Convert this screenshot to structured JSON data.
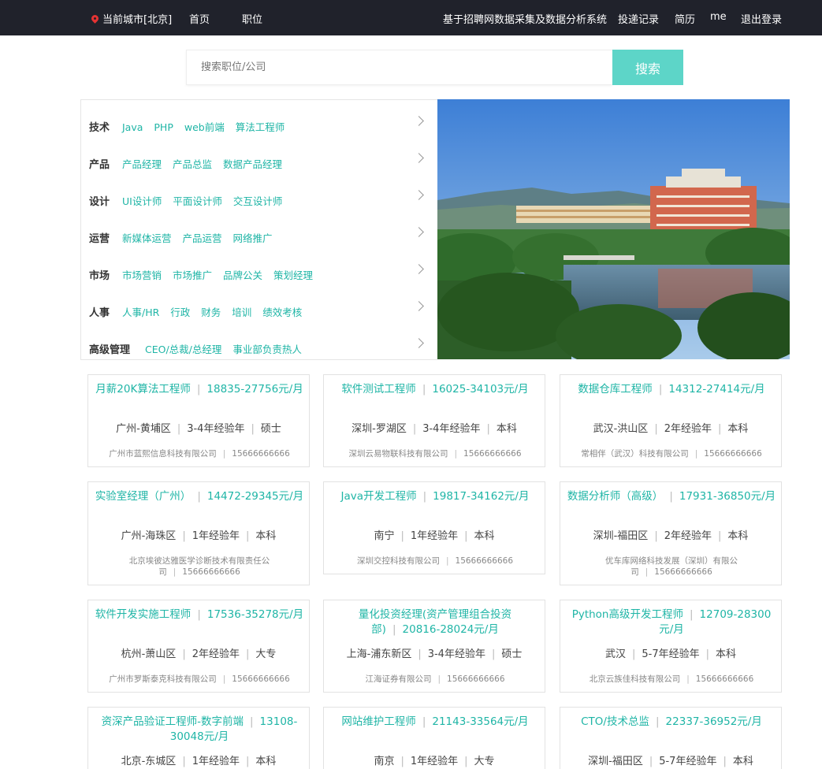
{
  "nav": {
    "city": "当前城市[北京]",
    "home": "首页",
    "jobs": "职位",
    "system": "基于招聘网数据采集及数据分析系统",
    "applications": "投递记录",
    "resume": "简历",
    "me": "me",
    "logout": "退出登录"
  },
  "search": {
    "placeholder": "搜索职位/公司",
    "button": "搜索"
  },
  "categories": [
    {
      "title": "技术",
      "links": [
        "Java",
        "PHP",
        "web前端",
        "算法工程师"
      ]
    },
    {
      "title": "产品",
      "links": [
        "产品经理",
        "产品总监",
        "数据产品经理"
      ]
    },
    {
      "title": "设计",
      "links": [
        "UI设计师",
        "平面设计师",
        "交互设计师"
      ]
    },
    {
      "title": "运营",
      "links": [
        "新媒体运营",
        "产品运营",
        "网络推广"
      ]
    },
    {
      "title": "市场",
      "links": [
        "市场营销",
        "市场推广",
        "品牌公关",
        "策划经理"
      ]
    },
    {
      "title": "人事",
      "links": [
        "人事/HR",
        "行政",
        "财务",
        "培训",
        "绩效考核"
      ]
    },
    {
      "title": "高级管理",
      "links": [
        "CEO/总裁/总经理",
        "事业部负责热人"
      ]
    }
  ],
  "separator": "|",
  "jobs": [
    {
      "title": "月薪20K算法工程师",
      "salary": "18835-27756元/月",
      "location": "广州-黄埔区",
      "experience": "3-4年经验年",
      "education": "硕士",
      "company": "广州市蓝熙信息科技有限公司",
      "phone": "15666666666"
    },
    {
      "title": "软件测试工程师",
      "salary": "16025-34103元/月",
      "location": "深圳-罗湖区",
      "experience": "3-4年经验年",
      "education": "本科",
      "company": "深圳云易物联科技有限公司",
      "phone": "15666666666"
    },
    {
      "title": "数据仓库工程师",
      "salary": "14312-27414元/月",
      "location": "武汉-洪山区",
      "experience": "2年经验年",
      "education": "本科",
      "company": "常相伴（武汉）科技有限公司",
      "phone": "15666666666"
    },
    {
      "title": "实验室经理（广州）",
      "salary": "14472-29345元/月",
      "location": "广州-海珠区",
      "experience": "1年经验年",
      "education": "本科",
      "company": "北京埃彼达雅医学诊断技术有限责任公司",
      "phone": "15666666666"
    },
    {
      "title": "Java开发工程师",
      "salary": "19817-34162元/月",
      "location": "南宁",
      "experience": "1年经验年",
      "education": "本科",
      "company": "深圳交控科技有限公司",
      "phone": "15666666666"
    },
    {
      "title": "数据分析师（高级）",
      "salary": "17931-36850元/月",
      "location": "深圳-福田区",
      "experience": "2年经验年",
      "education": "本科",
      "company": "优车库网络科技发展（深圳）有限公司",
      "phone": "15666666666"
    },
    {
      "title": "软件开发实施工程师",
      "salary": "17536-35278元/月",
      "location": "杭州-萧山区",
      "experience": "2年经验年",
      "education": "大专",
      "company": "广州市罗斯泰克科技有限公司",
      "phone": "15666666666"
    },
    {
      "title": "量化投资经理(资产管理组合投资部)",
      "salary": "20816-28024元/月",
      "location": "上海-浦东新区",
      "experience": "3-4年经验年",
      "education": "硕士",
      "company": "江海证券有限公司",
      "phone": "15666666666"
    },
    {
      "title": "Python高级开发工程师",
      "salary": "12709-28300元/月",
      "location": "武汉",
      "experience": "5-7年经验年",
      "education": "本科",
      "company": "北京云族佳科技有限公司",
      "phone": "15666666666"
    },
    {
      "title": "资深产品验证工程师-数字前端",
      "salary": "13108-30048元/月",
      "location": "北京-东城区",
      "experience": "1年经验年",
      "education": "本科",
      "company": "",
      "phone": ""
    },
    {
      "title": "网站维护工程师",
      "salary": "21143-33564元/月",
      "location": "南京",
      "experience": "1年经验年",
      "education": "大专",
      "company": "",
      "phone": ""
    },
    {
      "title": "CTO/技术总监",
      "salary": "22337-36952元/月",
      "location": "深圳-福田区",
      "experience": "5-7年经验年",
      "education": "本科",
      "company": "",
      "phone": ""
    }
  ]
}
